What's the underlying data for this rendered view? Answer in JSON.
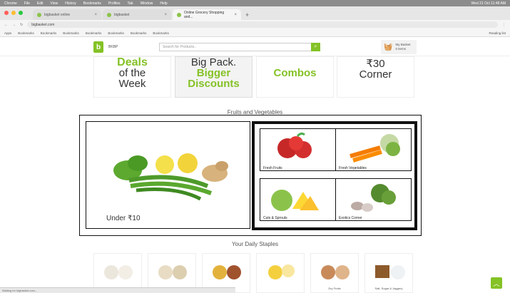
{
  "browser": {
    "menu": [
      "Chrome",
      "File",
      "Edit",
      "View",
      "History",
      "Bookmarks",
      "Profiles",
      "Tab",
      "Window",
      "Help"
    ],
    "clock": "Wed 21 Oct 11:48 AM",
    "tabs": [
      {
        "label": "bigbasket online",
        "active": false
      },
      {
        "label": "bigbasket",
        "active": false
      },
      {
        "label": "Online Grocery Shopping and...",
        "active": true
      }
    ],
    "url": "bigbasket.com",
    "bookmarks": [
      "Apps",
      "Bookmarks",
      "Bookmarks",
      "Bookmarks",
      "Bookmarks",
      "Bookmarks",
      "Bookmarks",
      "Bookmarks"
    ],
    "reading_list": "Reading list",
    "status_text": "Waiting for bigbasket.com..."
  },
  "site": {
    "logo_text": "b",
    "location": "BKBP",
    "search_placeholder": "Search for Products..",
    "basket_line1": "My Basket",
    "basket_line2": "0 items"
  },
  "promos": {
    "deals": {
      "l1": "Deals",
      "l2": "of the",
      "l3": "Week"
    },
    "pack": {
      "l1": "Big Pack.",
      "l2": "Bigger",
      "l3": "Discounts"
    },
    "combos": {
      "l1": "Combos"
    },
    "corner": {
      "l1": "₹30",
      "l2": "Corner"
    }
  },
  "fruits_section": {
    "title": "Fruits and Vegetables",
    "banner_label": "Under ₹10",
    "cells": [
      "Fresh Fruits",
      "Fresh Vegetables",
      "Cuts & Sprouts",
      "Exotics Corner"
    ]
  },
  "staples_section": {
    "title": "Your Daily Staples",
    "items": [
      "",
      "",
      "",
      "",
      "Dry Fruits",
      "Salt, Sugar & Jaggery"
    ]
  },
  "colors": {
    "brand": "#84c225",
    "basket": "#d32f2f"
  },
  "icons": [
    "search-icon",
    "basket-icon",
    "scroll-top-icon"
  ]
}
